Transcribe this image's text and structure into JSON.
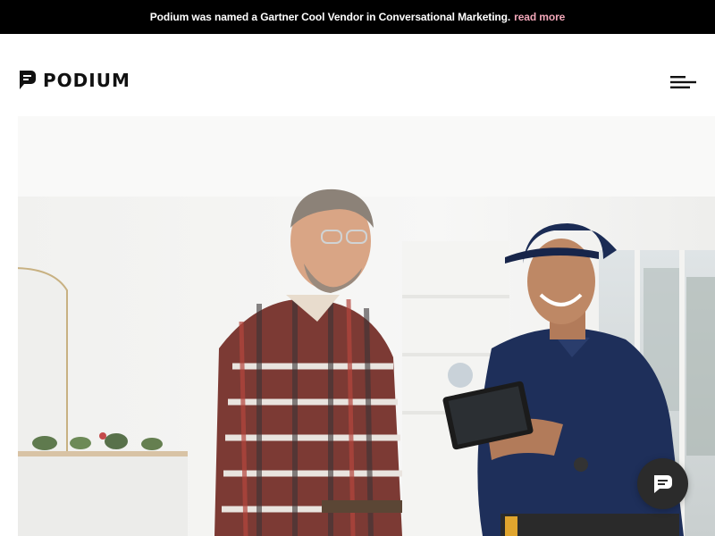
{
  "banner": {
    "text": "Podium was named a Gartner Cool Vendor in Conversational Marketing.",
    "link_label": "read more",
    "link_color": "#f2a7b9"
  },
  "header": {
    "logo_text": "PODIUM",
    "logo_icon": "podium-chat-logo-icon",
    "menu_icon": "hamburger-menu-icon"
  },
  "hero": {
    "image": "photo-two-men-looking-at-tablet"
  },
  "chat_widget": {
    "icon": "chat-bubble-icon",
    "background": "#2b2b2b"
  }
}
